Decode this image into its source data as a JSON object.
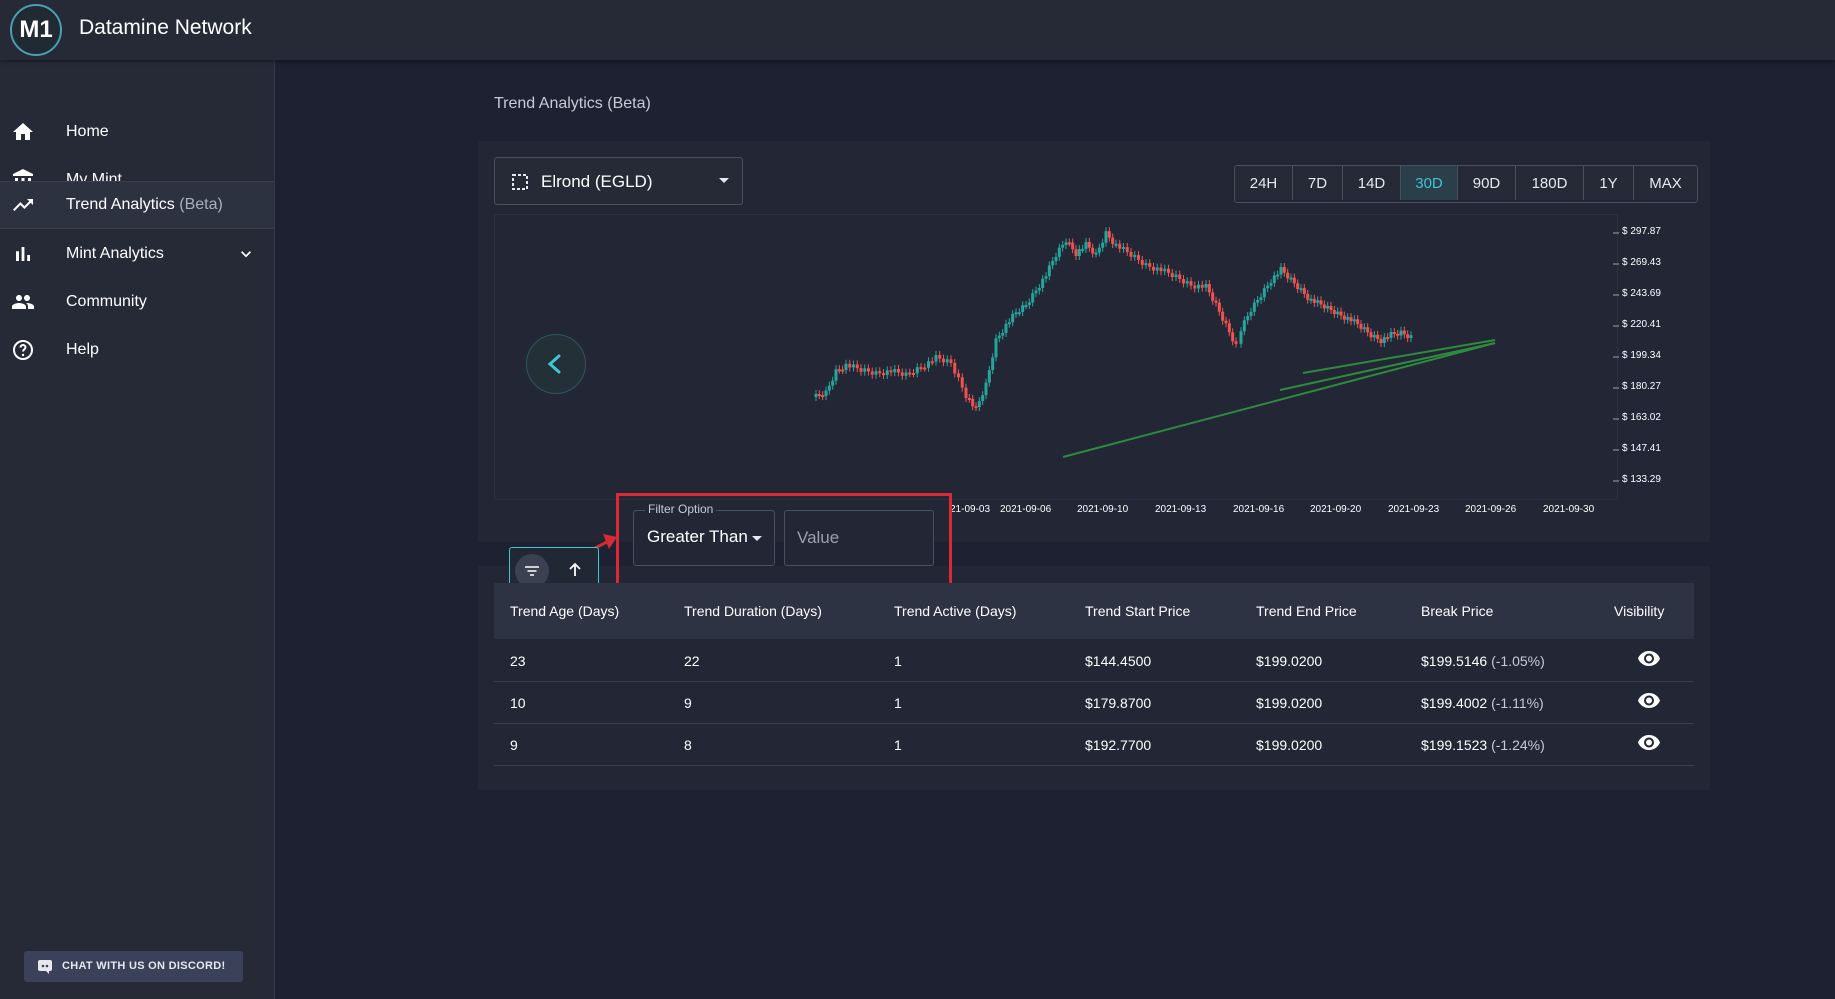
{
  "app": {
    "title": "Datamine Network",
    "logo_text": "M1"
  },
  "sidebar": {
    "items": [
      {
        "label": "Home",
        "icon": "home-icon"
      },
      {
        "label": "My Mint",
        "icon": "bank-icon"
      },
      {
        "label": "Trend Analytics",
        "suffix": "(Beta)",
        "icon": "trending-up-icon",
        "active": true
      },
      {
        "label": "Mint Analytics",
        "icon": "bar-chart-icon",
        "expandable": true
      },
      {
        "label": "Community",
        "icon": "people-icon"
      },
      {
        "label": "Help",
        "icon": "help-circle-icon"
      }
    ],
    "discord_label": "CHAT WITH US ON DISCORD!"
  },
  "page": {
    "title": "Trend Analytics (Beta)"
  },
  "coin_select": {
    "label": "Elrond (EGLD)"
  },
  "ranges": {
    "options": [
      "24H",
      "7D",
      "14D",
      "30D",
      "90D",
      "180D",
      "1Y",
      "MAX"
    ],
    "active": "30D"
  },
  "chart_data": {
    "type": "candlestick",
    "price_ticks": [
      "$ 297.87",
      "$ 269.43",
      "$ 243.69",
      "$ 220.41",
      "$ 199.34",
      "$ 180.27",
      "$ 163.02",
      "$ 147.41",
      "$ 133.29"
    ],
    "date_ticks": [
      "21-09-03",
      "2021-09-06",
      "2021-09-10",
      "2021-09-13",
      "2021-09-16",
      "2021-09-20",
      "2021-09-23",
      "2021-09-26",
      "2021-09-30"
    ]
  },
  "filter": {
    "legend": "Filter Option",
    "selected": "Greater Than",
    "value_placeholder": "Value"
  },
  "table": {
    "headers": [
      "Trend Age (Days)",
      "Trend Duration (Days)",
      "Trend Active (Days)",
      "Trend Start Price",
      "Trend End Price",
      "Break Price",
      "Visibility"
    ],
    "rows": [
      {
        "age": "23",
        "duration": "22",
        "active": "1",
        "start": "$144.4500",
        "end": "$199.0200",
        "break": "$199.5146",
        "pct": "(-1.05%)"
      },
      {
        "age": "10",
        "duration": "9",
        "active": "1",
        "start": "$179.8700",
        "end": "$199.0200",
        "break": "$199.4002",
        "pct": "(-1.11%)"
      },
      {
        "age": "9",
        "duration": "8",
        "active": "1",
        "start": "$192.7700",
        "end": "$199.0200",
        "break": "$199.1523",
        "pct": "(-1.24%)"
      }
    ]
  },
  "colors": {
    "accent": "#3fc4d6",
    "up": "#26a69a",
    "down": "#ef5350",
    "trend": "#2e8b3e",
    "highlight": "#d72a35"
  }
}
